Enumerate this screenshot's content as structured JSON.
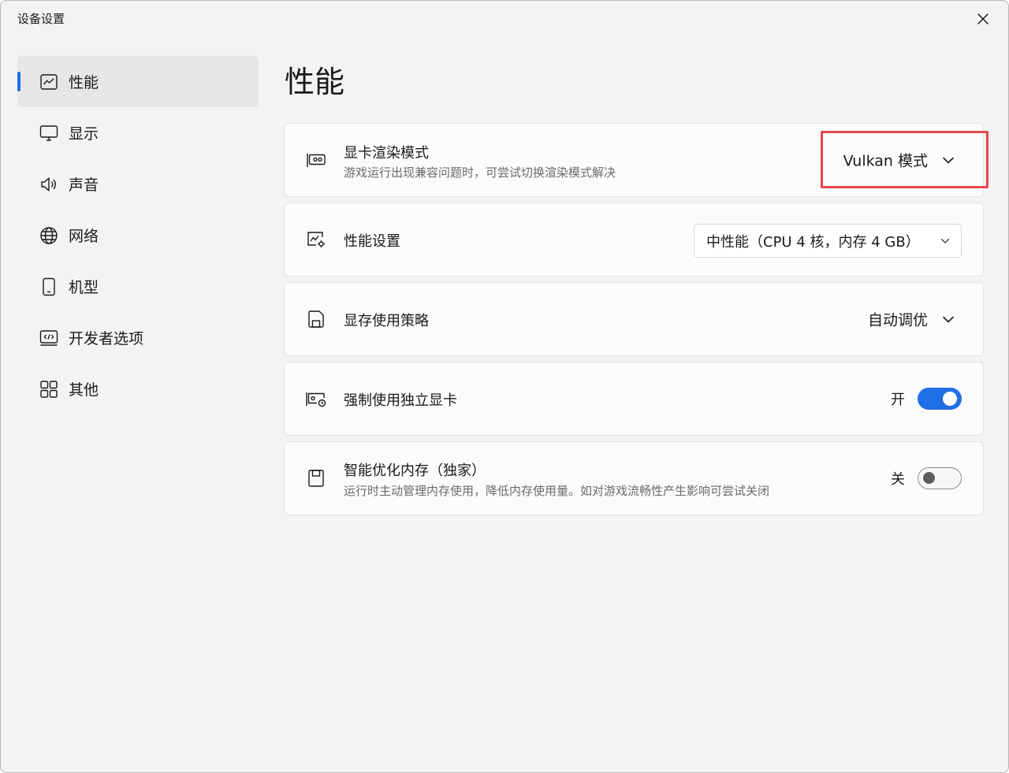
{
  "window": {
    "title": "设备设置"
  },
  "sidebar": {
    "items": [
      {
        "label": "性能",
        "icon": "performance-chart-icon",
        "active": true
      },
      {
        "label": "显示",
        "icon": "monitor-icon"
      },
      {
        "label": "声音",
        "icon": "speaker-icon"
      },
      {
        "label": "网络",
        "icon": "globe-icon"
      },
      {
        "label": "机型",
        "icon": "phone-icon"
      },
      {
        "label": "开发者选项",
        "icon": "code-icon"
      },
      {
        "label": "其他",
        "icon": "grid-icon"
      }
    ]
  },
  "main": {
    "title": "性能",
    "cards": [
      {
        "title": "显卡渲染模式",
        "subtitle": "游戏运行出现兼容问题时，可尝试切换渲染模式解决",
        "value": "Vulkan 模式",
        "icon": "gpu-card-icon"
      },
      {
        "title": "性能设置",
        "value": "中性能（CPU 4 核，内存 4 GB）",
        "icon": "performance-settings-icon"
      },
      {
        "title": "显存使用策略",
        "value": "自动调优",
        "icon": "save-disk-icon"
      },
      {
        "title": "强制使用独立显卡",
        "toggle_label": "开",
        "toggle_on": true,
        "icon": "gpu-clock-icon"
      },
      {
        "title": "智能优化内存（独家）",
        "subtitle": "运行时主动管理内存使用，降低内存使用量。如对游戏流畅性产生影响可尝试关闭",
        "toggle_label": "关",
        "toggle_on": false,
        "icon": "memory-disk-icon"
      }
    ]
  },
  "colors": {
    "accent": "#1f6fe5",
    "highlight": "#e8474d",
    "background": "#f3f3f3",
    "card": "#fbfbfb"
  }
}
